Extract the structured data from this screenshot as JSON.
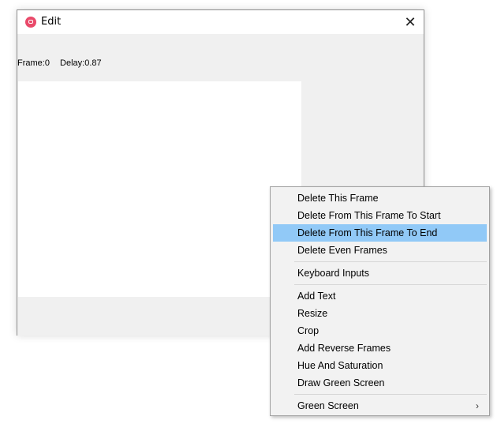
{
  "window": {
    "title": "Edit",
    "icon": "app-icon",
    "close_label": "✕",
    "frame_label": "Frame:0",
    "delay_label": "Delay:0.87"
  },
  "menu": {
    "items": [
      {
        "label": "Delete This Frame"
      },
      {
        "label": "Delete From This Frame To Start"
      },
      {
        "label": "Delete From This Frame To End",
        "highlighted": true
      },
      {
        "label": "Delete Even Frames"
      },
      {
        "label": "Keyboard Inputs"
      },
      {
        "label": "Add Text"
      },
      {
        "label": "Resize"
      },
      {
        "label": "Crop"
      },
      {
        "label": "Add Reverse Frames"
      },
      {
        "label": "Hue And Saturation"
      },
      {
        "label": "Draw Green Screen"
      },
      {
        "label": "Green Screen",
        "submenu_arrow": "›"
      }
    ],
    "highlight_color": "#91c9f7"
  }
}
